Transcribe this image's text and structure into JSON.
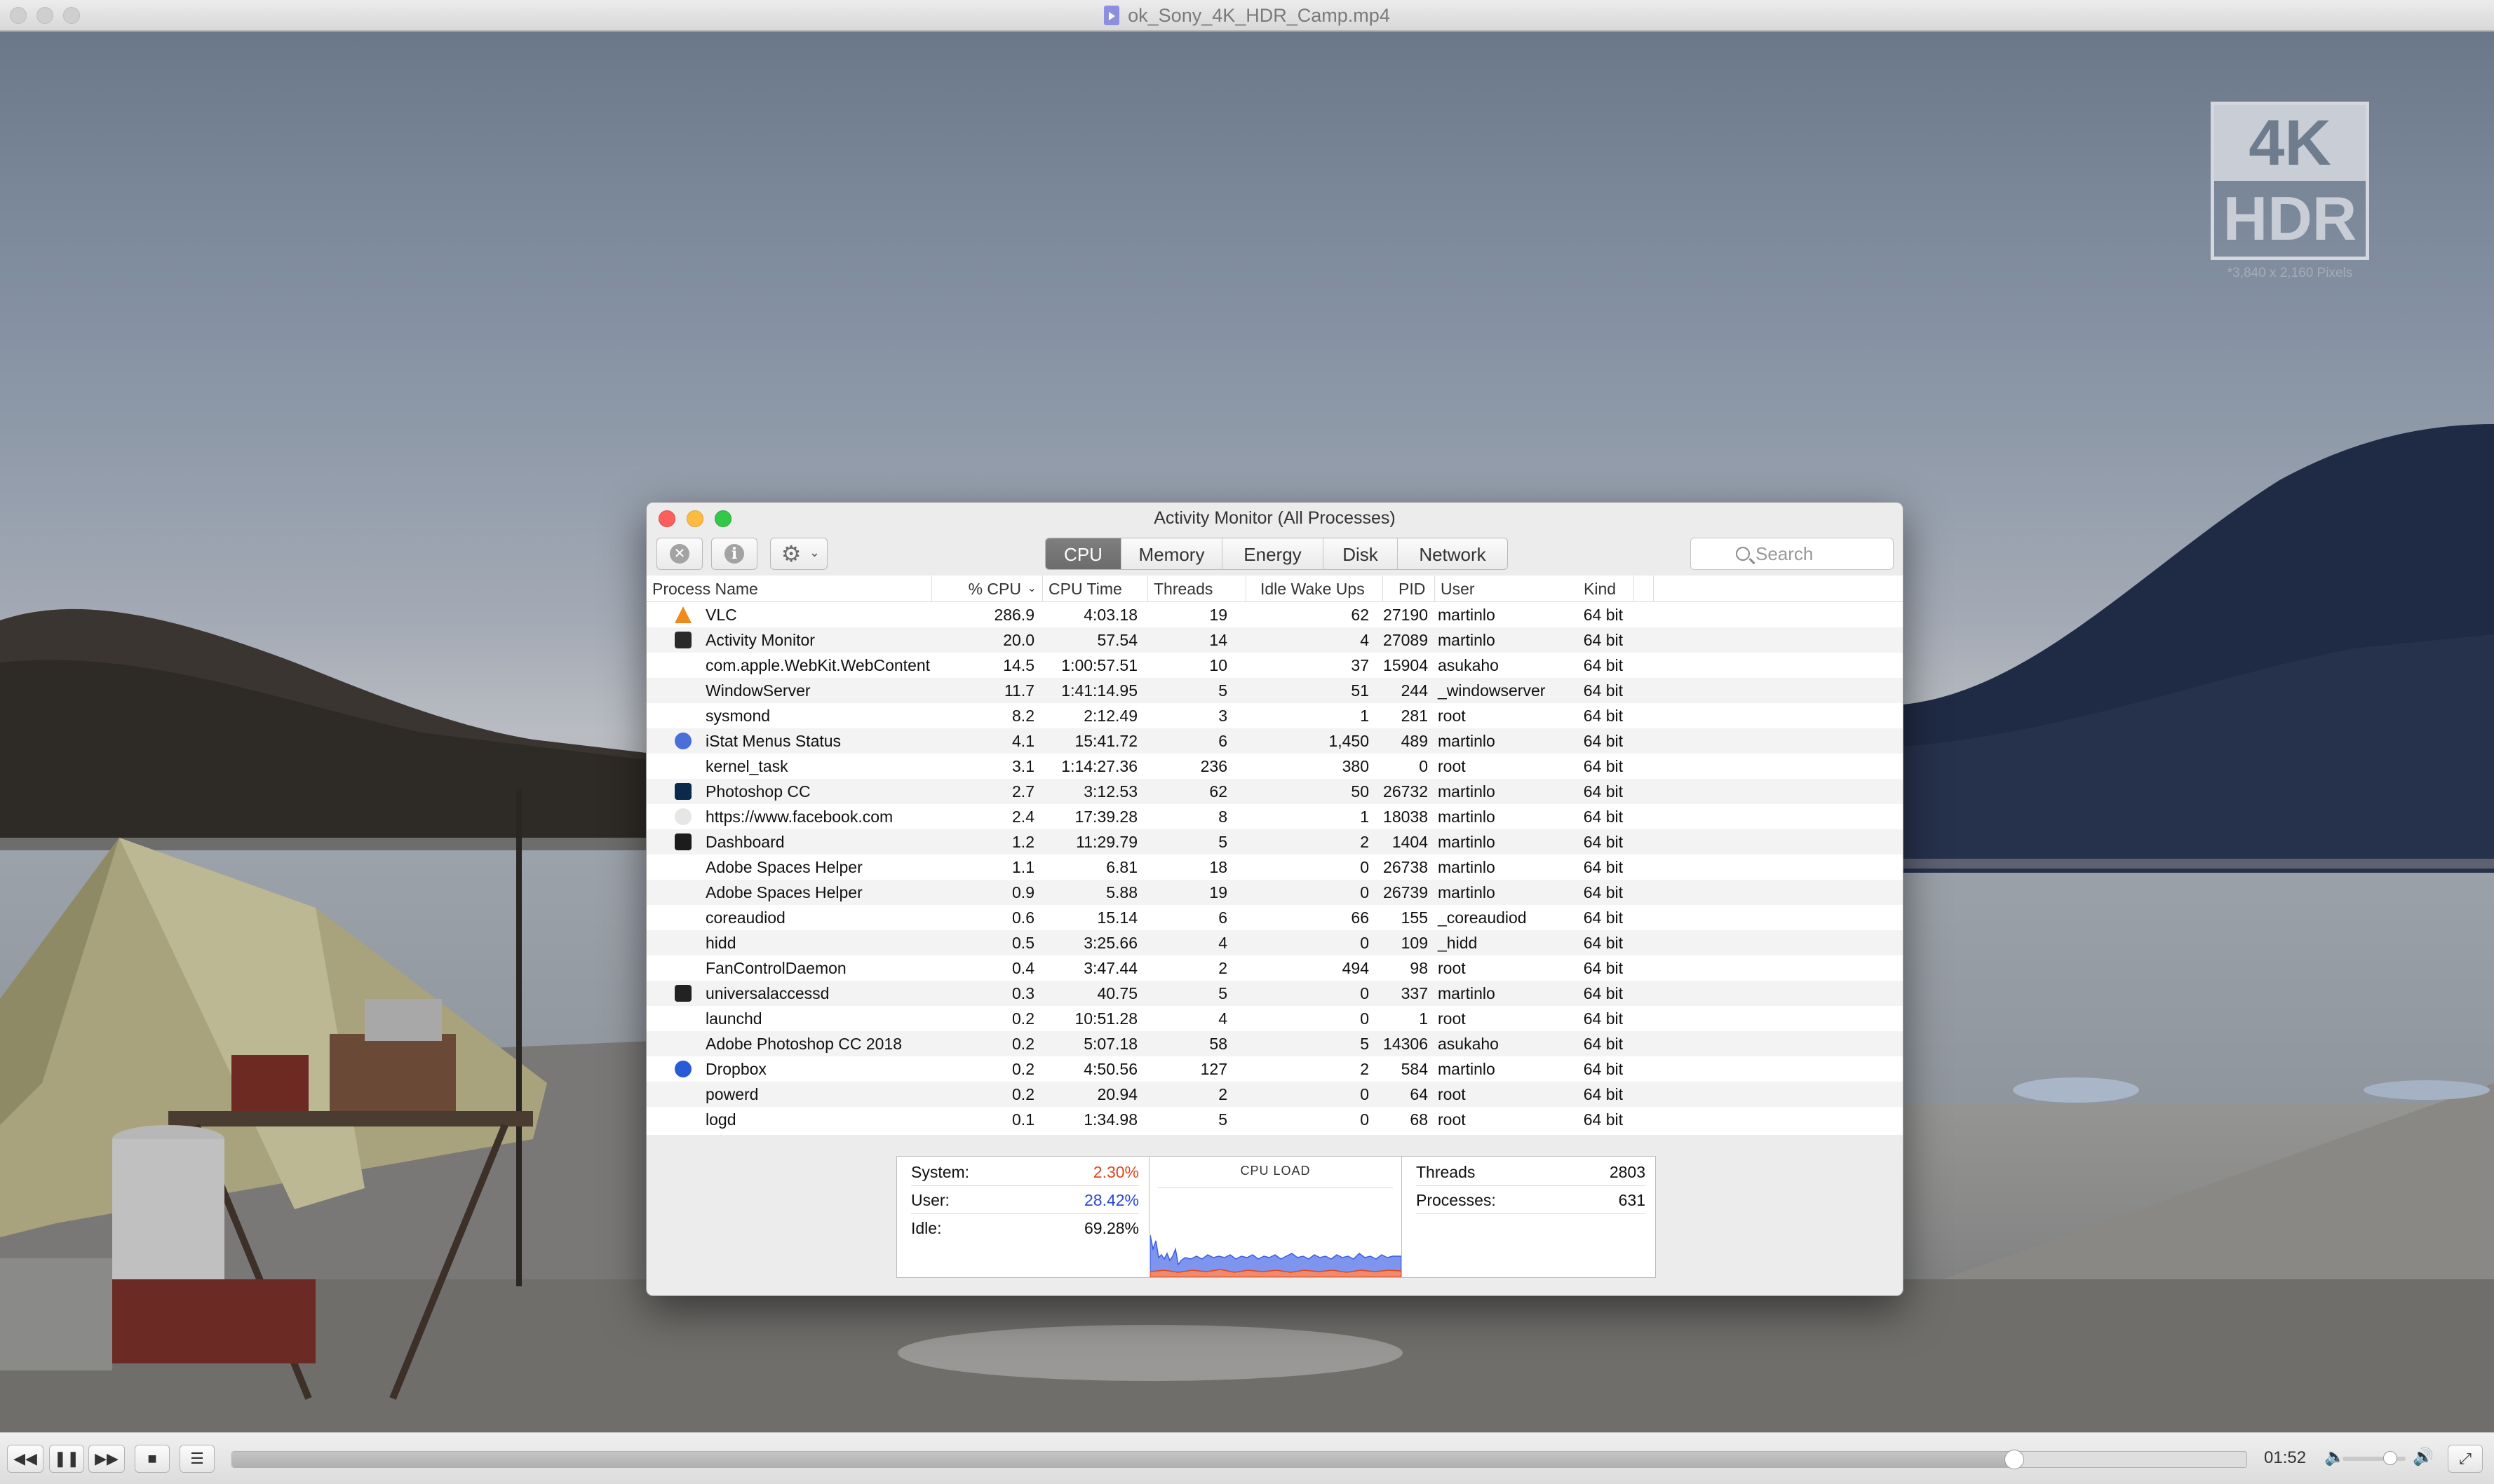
{
  "player": {
    "window_title": "ok_Sony_4K_HDR_Camp.mp4",
    "badge": {
      "top": "4K",
      "bottom": "HDR",
      "caption": "*3,840 x 2,160 Pixels"
    },
    "time": "01:52",
    "playback_progress": 0.884,
    "volume_level": 0.75
  },
  "activity_monitor": {
    "title": "Activity Monitor (All Processes)",
    "tabs": [
      {
        "label": "CPU",
        "active": true
      },
      {
        "label": "Memory",
        "active": false
      },
      {
        "label": "Energy",
        "active": false
      },
      {
        "label": "Disk",
        "active": false
      },
      {
        "label": "Network",
        "active": false
      }
    ],
    "search_placeholder": "Search",
    "columns": {
      "name": "Process Name",
      "cpu": "% CPU",
      "time": "CPU Time",
      "threads": "Threads",
      "idle": "Idle Wake Ups",
      "pid": "PID",
      "user": "User",
      "kind": "Kind"
    },
    "processes": [
      {
        "name": "VLC",
        "cpu": "286.9",
        "time": "4:03.18",
        "threads": "19",
        "idle": "62",
        "pid": "27190",
        "user": "martinlo",
        "kind": "64 bit",
        "icon": "vlc-icon",
        "icon_color": "#f08a1c"
      },
      {
        "name": "Activity Monitor",
        "cpu": "20.0",
        "time": "57.54",
        "threads": "14",
        "idle": "4",
        "pid": "27089",
        "user": "martinlo",
        "kind": "64 bit",
        "icon": "activity-monitor-icon",
        "icon_color": "#2a2a2a"
      },
      {
        "name": "com.apple.WebKit.WebContent",
        "cpu": "14.5",
        "time": "1:00:57.51",
        "threads": "10",
        "idle": "37",
        "pid": "15904",
        "user": "asukaho",
        "kind": "64 bit",
        "icon": "",
        "icon_color": ""
      },
      {
        "name": "WindowServer",
        "cpu": "11.7",
        "time": "1:41:14.95",
        "threads": "5",
        "idle": "51",
        "pid": "244",
        "user": "_windowserver",
        "kind": "64 bit",
        "icon": "",
        "icon_color": ""
      },
      {
        "name": "sysmond",
        "cpu": "8.2",
        "time": "2:12.49",
        "threads": "3",
        "idle": "1",
        "pid": "281",
        "user": "root",
        "kind": "64 bit",
        "icon": "",
        "icon_color": ""
      },
      {
        "name": "iStat Menus Status",
        "cpu": "4.1",
        "time": "15:41.72",
        "threads": "6",
        "idle": "1,450",
        "pid": "489",
        "user": "martinlo",
        "kind": "64 bit",
        "icon": "istat-icon",
        "icon_color": "#4a6fd6"
      },
      {
        "name": "kernel_task",
        "cpu": "3.1",
        "time": "1:14:27.36",
        "threads": "236",
        "idle": "380",
        "pid": "0",
        "user": "root",
        "kind": "64 bit",
        "icon": "",
        "icon_color": ""
      },
      {
        "name": "Photoshop CC",
        "cpu": "2.7",
        "time": "3:12.53",
        "threads": "62",
        "idle": "50",
        "pid": "26732",
        "user": "martinlo",
        "kind": "64 bit",
        "icon": "photoshop-icon",
        "icon_color": "#0b2a4a"
      },
      {
        "name": "https://www.facebook.com",
        "cpu": "2.4",
        "time": "17:39.28",
        "threads": "8",
        "idle": "1",
        "pid": "18038",
        "user": "martinlo",
        "kind": "64 bit",
        "icon": "shield-icon",
        "icon_color": "#e6e6e6"
      },
      {
        "name": "Dashboard",
        "cpu": "1.2",
        "time": "11:29.79",
        "threads": "5",
        "idle": "2",
        "pid": "1404",
        "user": "martinlo",
        "kind": "64 bit",
        "icon": "dashboard-icon",
        "icon_color": "#1c1c1c"
      },
      {
        "name": "Adobe Spaces Helper",
        "cpu": "1.1",
        "time": "6.81",
        "threads": "18",
        "idle": "0",
        "pid": "26738",
        "user": "martinlo",
        "kind": "64 bit",
        "icon": "",
        "icon_color": ""
      },
      {
        "name": "Adobe Spaces Helper",
        "cpu": "0.9",
        "time": "5.88",
        "threads": "19",
        "idle": "0",
        "pid": "26739",
        "user": "martinlo",
        "kind": "64 bit",
        "icon": "",
        "icon_color": ""
      },
      {
        "name": "coreaudiod",
        "cpu": "0.6",
        "time": "15.14",
        "threads": "6",
        "idle": "66",
        "pid": "155",
        "user": "_coreaudiod",
        "kind": "64 bit",
        "icon": "",
        "icon_color": ""
      },
      {
        "name": "hidd",
        "cpu": "0.5",
        "time": "3:25.66",
        "threads": "4",
        "idle": "0",
        "pid": "109",
        "user": "_hidd",
        "kind": "64 bit",
        "icon": "",
        "icon_color": ""
      },
      {
        "name": "FanControlDaemon",
        "cpu": "0.4",
        "time": "3:47.44",
        "threads": "2",
        "idle": "494",
        "pid": "98",
        "user": "root",
        "kind": "64 bit",
        "icon": "",
        "icon_color": ""
      },
      {
        "name": "universalaccessd",
        "cpu": "0.3",
        "time": "40.75",
        "threads": "5",
        "idle": "0",
        "pid": "337",
        "user": "martinlo",
        "kind": "64 bit",
        "icon": "terminal-icon",
        "icon_color": "#222222"
      },
      {
        "name": "launchd",
        "cpu": "0.2",
        "time": "10:51.28",
        "threads": "4",
        "idle": "0",
        "pid": "1",
        "user": "root",
        "kind": "64 bit",
        "icon": "",
        "icon_color": ""
      },
      {
        "name": "Adobe Photoshop CC 2018",
        "cpu": "0.2",
        "time": "5:07.18",
        "threads": "58",
        "idle": "5",
        "pid": "14306",
        "user": "asukaho",
        "kind": "64 bit",
        "icon": "",
        "icon_color": ""
      },
      {
        "name": "Dropbox",
        "cpu": "0.2",
        "time": "4:50.56",
        "threads": "127",
        "idle": "2",
        "pid": "584",
        "user": "martinlo",
        "kind": "64 bit",
        "icon": "dropbox-icon",
        "icon_color": "#2a5bd7"
      },
      {
        "name": "powerd",
        "cpu": "0.2",
        "time": "20.94",
        "threads": "2",
        "idle": "0",
        "pid": "64",
        "user": "root",
        "kind": "64 bit",
        "icon": "",
        "icon_color": ""
      },
      {
        "name": "logd",
        "cpu": "0.1",
        "time": "1:34.98",
        "threads": "5",
        "idle": "0",
        "pid": "68",
        "user": "root",
        "kind": "64 bit",
        "icon": "",
        "icon_color": ""
      }
    ],
    "summary": {
      "system_label": "System:",
      "system_value": "2.30%",
      "system_color": "#e0461e",
      "user_label": "User:",
      "user_value": "28.42%",
      "user_color": "#2a46d8",
      "idle_label": "Idle:",
      "idle_value": "69.28%",
      "cpu_load_title": "CPU LOAD",
      "threads_label": "Threads",
      "threads_value": "2803",
      "processes_label": "Processes:",
      "processes_value": "631"
    }
  }
}
